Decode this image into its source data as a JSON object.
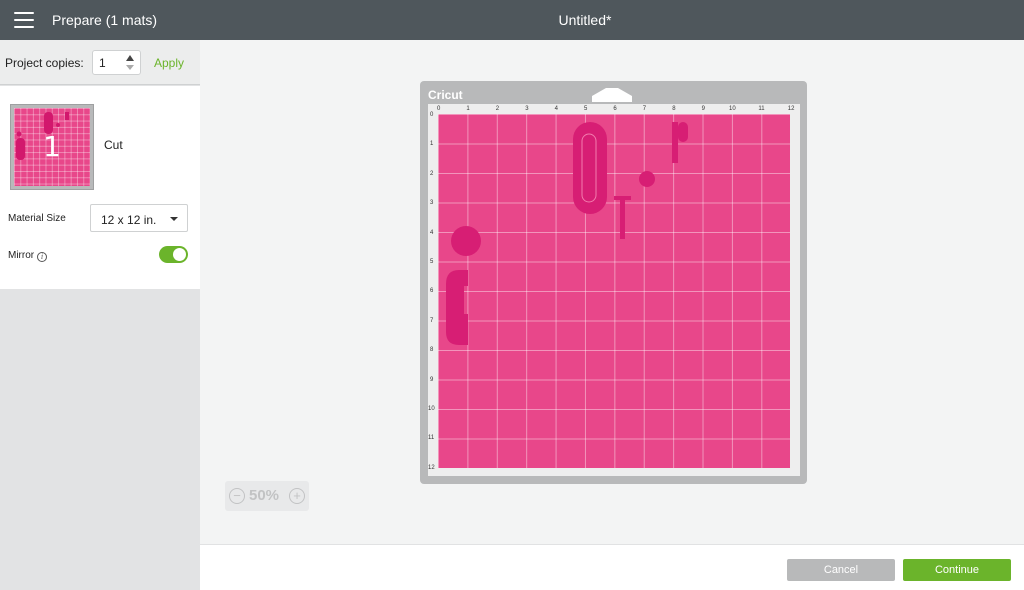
{
  "topbar": {
    "prepare_title": "Prepare (1 mats)",
    "document_title": "Untitled*"
  },
  "sidebar": {
    "copies_label": "Project copies:",
    "copies_value": "1",
    "apply_label": "Apply",
    "mat_number": "1",
    "mat_operation": "Cut",
    "material_size_label": "Material Size",
    "material_size_value": "12 x 12 in.",
    "mirror_label": "Mirror",
    "mirror_on": true
  },
  "canvas": {
    "brand": "Cricut",
    "ruler_top": [
      "0",
      "1",
      "2",
      "3",
      "4",
      "5",
      "6",
      "7",
      "8",
      "9",
      "10",
      "11",
      "12"
    ],
    "ruler_left": [
      "0",
      "1",
      "2",
      "3",
      "4",
      "5",
      "6",
      "7",
      "8",
      "9",
      "10",
      "11",
      "12"
    ],
    "shape_color": "#e0267a",
    "mat_color": "#e8478a"
  },
  "zoom": {
    "value": "50%",
    "minus": "−",
    "plus": "+"
  },
  "footer": {
    "cancel_label": "Cancel",
    "continue_label": "Continue"
  },
  "colors": {
    "accent_green": "#6bb42b",
    "topbar": "#4f575c",
    "cancel_gray": "#b8b9ba"
  }
}
